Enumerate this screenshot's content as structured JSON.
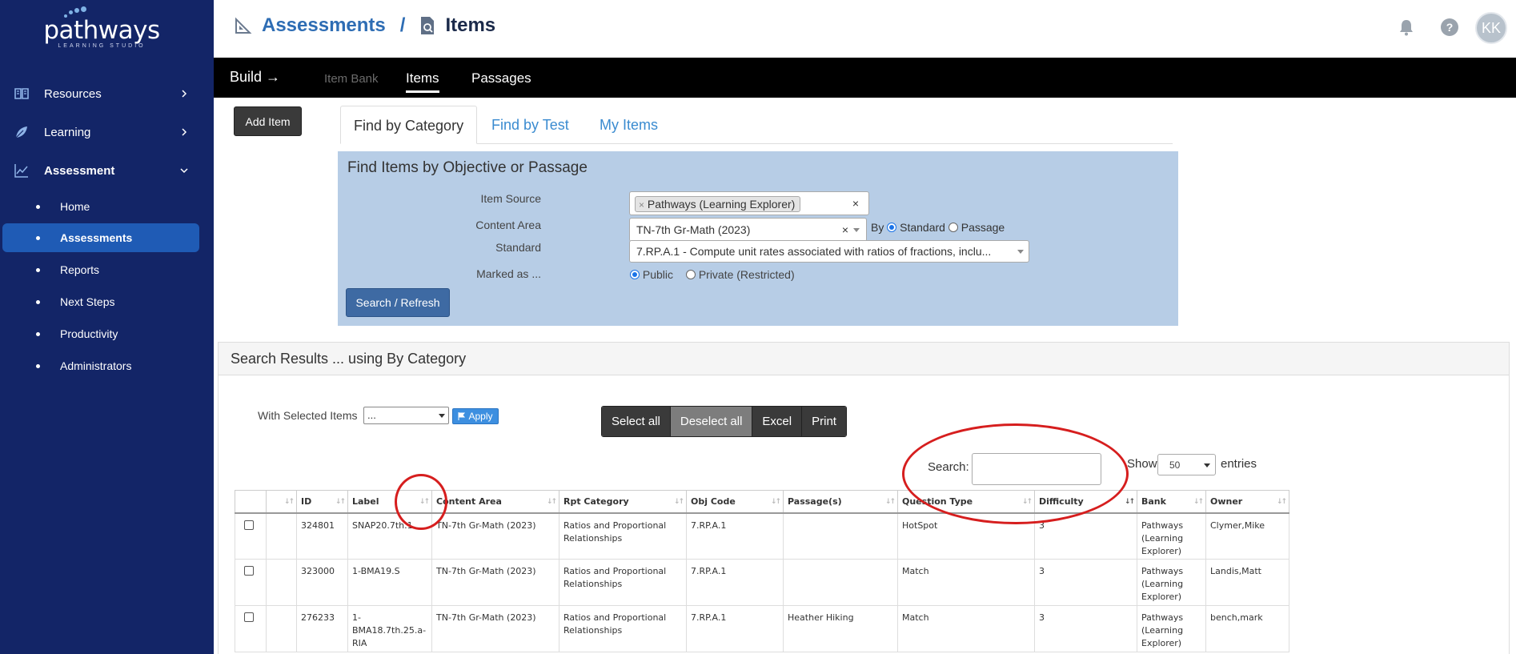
{
  "brand": {
    "name": "pathways",
    "tagline": "LEARNING STUDIO"
  },
  "sidebar": {
    "items": [
      {
        "label": "Resources",
        "icon": "book-icon",
        "expanded": false
      },
      {
        "label": "Learning",
        "icon": "leaf-icon",
        "expanded": false
      },
      {
        "label": "Assessment",
        "icon": "chart-icon",
        "expanded": true
      }
    ],
    "subitems": [
      {
        "label": "Home",
        "active": false
      },
      {
        "label": "Assessments",
        "active": true
      },
      {
        "label": "Reports",
        "active": false
      },
      {
        "label": "Next Steps",
        "active": false
      },
      {
        "label": "Productivity",
        "active": false
      },
      {
        "label": "Administrators",
        "active": false
      }
    ]
  },
  "header": {
    "breadcrumb_root": "Assessments",
    "breadcrumb_sep": "/",
    "breadcrumb_current": "Items",
    "avatar_initials": "KK"
  },
  "buildbar": {
    "label": "Build →",
    "tabs": [
      "Item Bank",
      "Items",
      "Passages"
    ],
    "active_tab": "Items"
  },
  "toolbar": {
    "add_item": "Add Item"
  },
  "find_tabs": {
    "tabs": [
      "Find by Category",
      "Find by Test",
      "My Items"
    ],
    "active": "Find by Category"
  },
  "find": {
    "title": "Find Items by Objective or Passage",
    "item_source_label": "Item Source",
    "item_source_value": "Pathways (Learning Explorer)",
    "content_area_label": "Content Area",
    "content_area_value": "TN-7th Gr-Math (2023)",
    "by_label": "By",
    "by_options": [
      "Standard",
      "Passage"
    ],
    "by_selected": "Standard",
    "standard_label": "Standard",
    "standard_value": "7.RP.A.1 - Compute unit rates associated with ratios of fractions, inclu...",
    "marked_label": "Marked as ...",
    "marked_options": [
      "Public",
      "Private (Restricted)"
    ],
    "marked_selected": "Public",
    "search_button": "Search / Refresh"
  },
  "results": {
    "title": "Search Results ... using By Category",
    "with_selected_label": "With Selected Items",
    "with_selected_value": "...",
    "apply_button": "Apply",
    "buttons": [
      "Select all",
      "Deselect all",
      "Excel",
      "Print"
    ],
    "search_label": "Search:",
    "search_value": "",
    "show_label": "Show",
    "show_value": "50",
    "entries_label": "entries",
    "columns": [
      "",
      "",
      "ID",
      "Label",
      "Content Area",
      "Rpt Category",
      "Obj Code",
      "Passage(s)",
      "Question Type",
      "Difficulty",
      "Bank",
      "Owner"
    ],
    "rows": [
      {
        "id": "324801",
        "label": "SNAP20.7th.1",
        "content_area": "TN-7th Gr-Math (2023)",
        "rpt_category": "Ratios and Proportional Relationships",
        "obj_code": "7.RP.A.1",
        "passages": "",
        "question_type": "HotSpot",
        "difficulty": "3",
        "bank": "Pathways (Learning Explorer)",
        "owner": "Clymer,Mike"
      },
      {
        "id": "323000",
        "label": "1-BMA19.S",
        "content_area": "TN-7th Gr-Math (2023)",
        "rpt_category": "Ratios and Proportional Relationships",
        "obj_code": "7.RP.A.1",
        "passages": "",
        "question_type": "Match",
        "difficulty": "3",
        "bank": "Pathways (Learning Explorer)",
        "owner": "Landis,Matt"
      },
      {
        "id": "276233",
        "label": "1-BMA18.7th.25.a-RIA",
        "content_area": "TN-7th Gr-Math (2023)",
        "rpt_category": "Ratios and Proportional Relationships",
        "obj_code": "7.RP.A.1",
        "passages": "Heather Hiking",
        "question_type": "Match",
        "difficulty": "3",
        "bank": "Pathways (Learning Explorer)",
        "owner": "bench,mark"
      }
    ]
  },
  "colors": {
    "sidebar_bg": "#132567",
    "active_item": "#1f5bb5",
    "link": "#2e6db4",
    "find_panel": "#b7cde6",
    "annotation": "#d61e1e"
  }
}
